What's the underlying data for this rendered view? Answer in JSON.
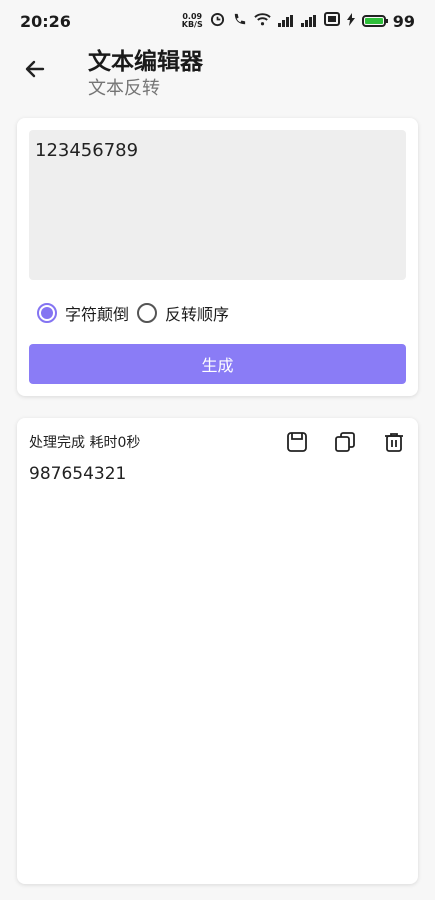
{
  "status_bar": {
    "time": "20:26",
    "net_speed_value": "0.09",
    "net_speed_unit": "KB/S",
    "battery": "99"
  },
  "header": {
    "title": "文本编辑器",
    "subtitle": "文本反转"
  },
  "editor": {
    "input_value": "123456789",
    "options": [
      {
        "label": "字符颠倒",
        "selected": true
      },
      {
        "label": "反转顺序",
        "selected": false
      }
    ],
    "generate_label": "生成"
  },
  "result": {
    "status": "处理完成 耗时0秒",
    "output": "987654321"
  },
  "colors": {
    "accent": "#8474f2",
    "button": "#8a7cf6",
    "battery": "#2fbf3a"
  }
}
